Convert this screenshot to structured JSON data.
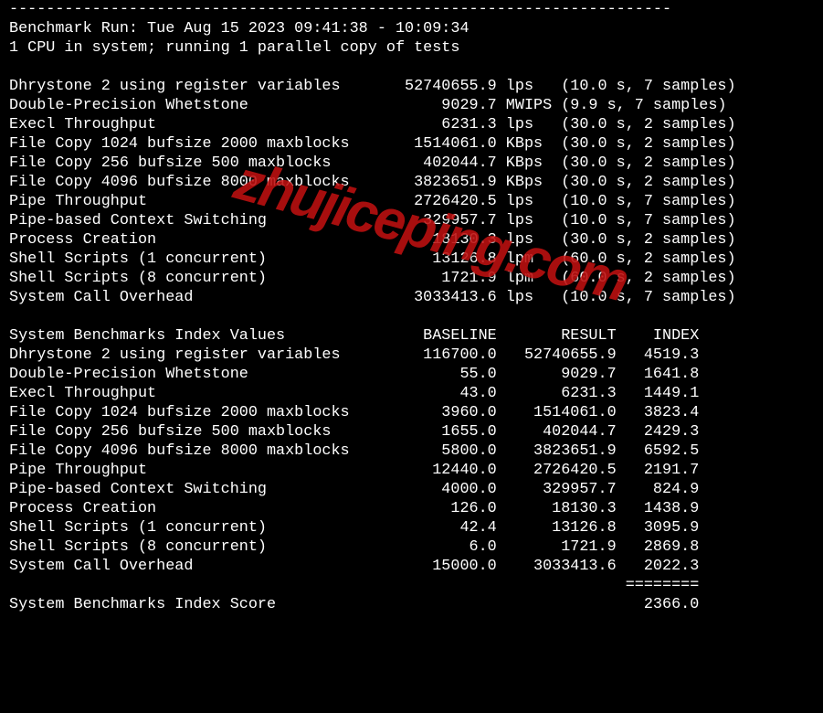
{
  "watermark": "zhujiceping.com",
  "dashline": "------------------------------------------------------------------------",
  "header": {
    "run_line": "Benchmark Run: Tue Aug 15 2023 09:41:38 - 10:09:34",
    "cpu_line": "1 CPU in system; running 1 parallel copy of tests"
  },
  "tests": [
    {
      "name": "Dhrystone 2 using register variables",
      "value": "52740655.9",
      "unit": "lps",
      "timing": "(10.0 s, 7 samples)"
    },
    {
      "name": "Double-Precision Whetstone",
      "value": "9029.7",
      "unit": "MWIPS",
      "timing": "(9.9 s, 7 samples)"
    },
    {
      "name": "Execl Throughput",
      "value": "6231.3",
      "unit": "lps",
      "timing": "(30.0 s, 2 samples)"
    },
    {
      "name": "File Copy 1024 bufsize 2000 maxblocks",
      "value": "1514061.0",
      "unit": "KBps",
      "timing": "(30.0 s, 2 samples)"
    },
    {
      "name": "File Copy 256 bufsize 500 maxblocks",
      "value": "402044.7",
      "unit": "KBps",
      "timing": "(30.0 s, 2 samples)"
    },
    {
      "name": "File Copy 4096 bufsize 8000 maxblocks",
      "value": "3823651.9",
      "unit": "KBps",
      "timing": "(30.0 s, 2 samples)"
    },
    {
      "name": "Pipe Throughput",
      "value": "2726420.5",
      "unit": "lps",
      "timing": "(10.0 s, 7 samples)"
    },
    {
      "name": "Pipe-based Context Switching",
      "value": "329957.7",
      "unit": "lps",
      "timing": "(10.0 s, 7 samples)"
    },
    {
      "name": "Process Creation",
      "value": "18130.3",
      "unit": "lps",
      "timing": "(30.0 s, 2 samples)"
    },
    {
      "name": "Shell Scripts (1 concurrent)",
      "value": "13126.8",
      "unit": "lpm",
      "timing": "(60.0 s, 2 samples)"
    },
    {
      "name": "Shell Scripts (8 concurrent)",
      "value": "1721.9",
      "unit": "lpm",
      "timing": "(60.0 s, 2 samples)"
    },
    {
      "name": "System Call Overhead",
      "value": "3033413.6",
      "unit": "lps",
      "timing": "(10.0 s, 7 samples)"
    }
  ],
  "index_header": {
    "label": "System Benchmarks Index Values",
    "col1": "BASELINE",
    "col2": "RESULT",
    "col3": "INDEX"
  },
  "index": [
    {
      "name": "Dhrystone 2 using register variables",
      "baseline": "116700.0",
      "result": "52740655.9",
      "index": "4519.3"
    },
    {
      "name": "Double-Precision Whetstone",
      "baseline": "55.0",
      "result": "9029.7",
      "index": "1641.8"
    },
    {
      "name": "Execl Throughput",
      "baseline": "43.0",
      "result": "6231.3",
      "index": "1449.1"
    },
    {
      "name": "File Copy 1024 bufsize 2000 maxblocks",
      "baseline": "3960.0",
      "result": "1514061.0",
      "index": "3823.4"
    },
    {
      "name": "File Copy 256 bufsize 500 maxblocks",
      "baseline": "1655.0",
      "result": "402044.7",
      "index": "2429.3"
    },
    {
      "name": "File Copy 4096 bufsize 8000 maxblocks",
      "baseline": "5800.0",
      "result": "3823651.9",
      "index": "6592.5"
    },
    {
      "name": "Pipe Throughput",
      "baseline": "12440.0",
      "result": "2726420.5",
      "index": "2191.7"
    },
    {
      "name": "Pipe-based Context Switching",
      "baseline": "4000.0",
      "result": "329957.7",
      "index": "824.9"
    },
    {
      "name": "Process Creation",
      "baseline": "126.0",
      "result": "18130.3",
      "index": "1438.9"
    },
    {
      "name": "Shell Scripts (1 concurrent)",
      "baseline": "42.4",
      "result": "13126.8",
      "index": "3095.9"
    },
    {
      "name": "Shell Scripts (8 concurrent)",
      "baseline": "6.0",
      "result": "1721.9",
      "index": "2869.8"
    },
    {
      "name": "System Call Overhead",
      "baseline": "15000.0",
      "result": "3033413.6",
      "index": "2022.3"
    }
  ],
  "score_rule": "========",
  "score": {
    "label": "System Benchmarks Index Score",
    "value": "2366.0"
  }
}
